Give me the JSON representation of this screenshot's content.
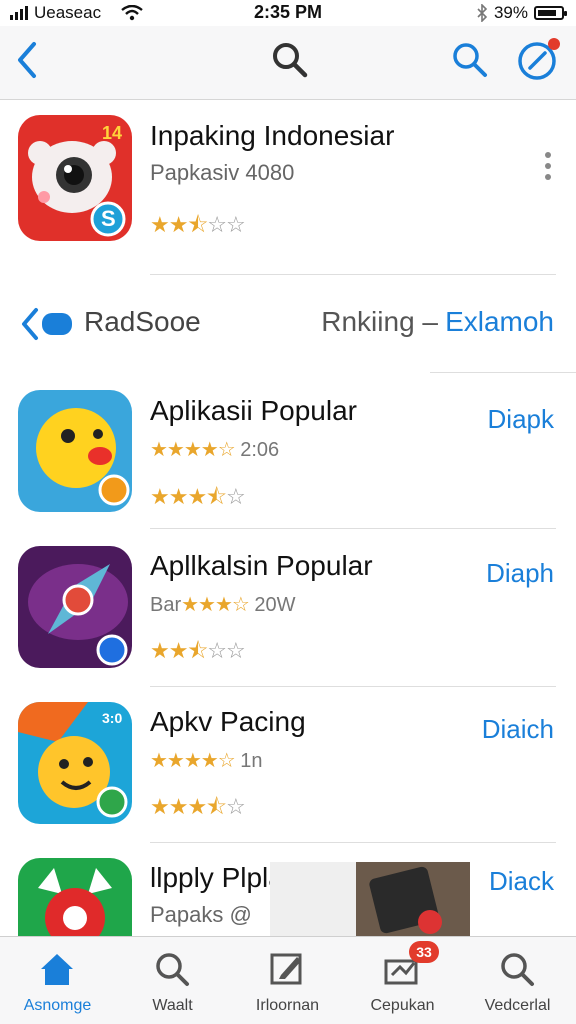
{
  "status_bar": {
    "carrier": "Ueaseac",
    "time": "2:35 PM",
    "battery": "39%"
  },
  "nav": {
    "back_icon": "chevron-left-icon",
    "center_icon": "search-icon",
    "right_icons": [
      "search-icon",
      "compass-icon"
    ]
  },
  "featured": {
    "title": "Inpaking Indonesiar",
    "subtitle": "Papkasiv 4080",
    "rating": 2.5,
    "icon_badge": "14",
    "icon_letter": "S"
  },
  "section": {
    "label": "RadSooe",
    "ranking": "Rnkiing –",
    "explore": "Exlamoh"
  },
  "apps": [
    {
      "title": "Aplikasii Popular",
      "sub_text": "2:06",
      "sub_rating": 4.5,
      "rating": 3.5,
      "action": "Diapk"
    },
    {
      "title": "Apllkalsin Popular",
      "sub_text": "Bar",
      "sub_rating": 3.5,
      "sub_text2": "20W",
      "rating": 2.5,
      "action": "Diaph"
    },
    {
      "title": "Apkv Pacing",
      "sub_text": "1n",
      "sub_rating": 4,
      "rating": 3.5,
      "action": "Diaich",
      "icon_label": "3:0"
    },
    {
      "title": "llpply Plplar",
      "sub_text": "Papaks @",
      "action": "Diack"
    }
  ],
  "tabs": [
    {
      "label": "Asnomge",
      "icon": "home-icon",
      "active": true
    },
    {
      "label": "Waalt",
      "icon": "search-icon",
      "active": false
    },
    {
      "label": "Irloornan",
      "icon": "edit-icon",
      "active": false
    },
    {
      "label": "Cepukan",
      "icon": "inbox-icon",
      "active": false,
      "badge": "33"
    },
    {
      "label": "Vedcerlal",
      "icon": "search-icon",
      "active": false
    }
  ]
}
